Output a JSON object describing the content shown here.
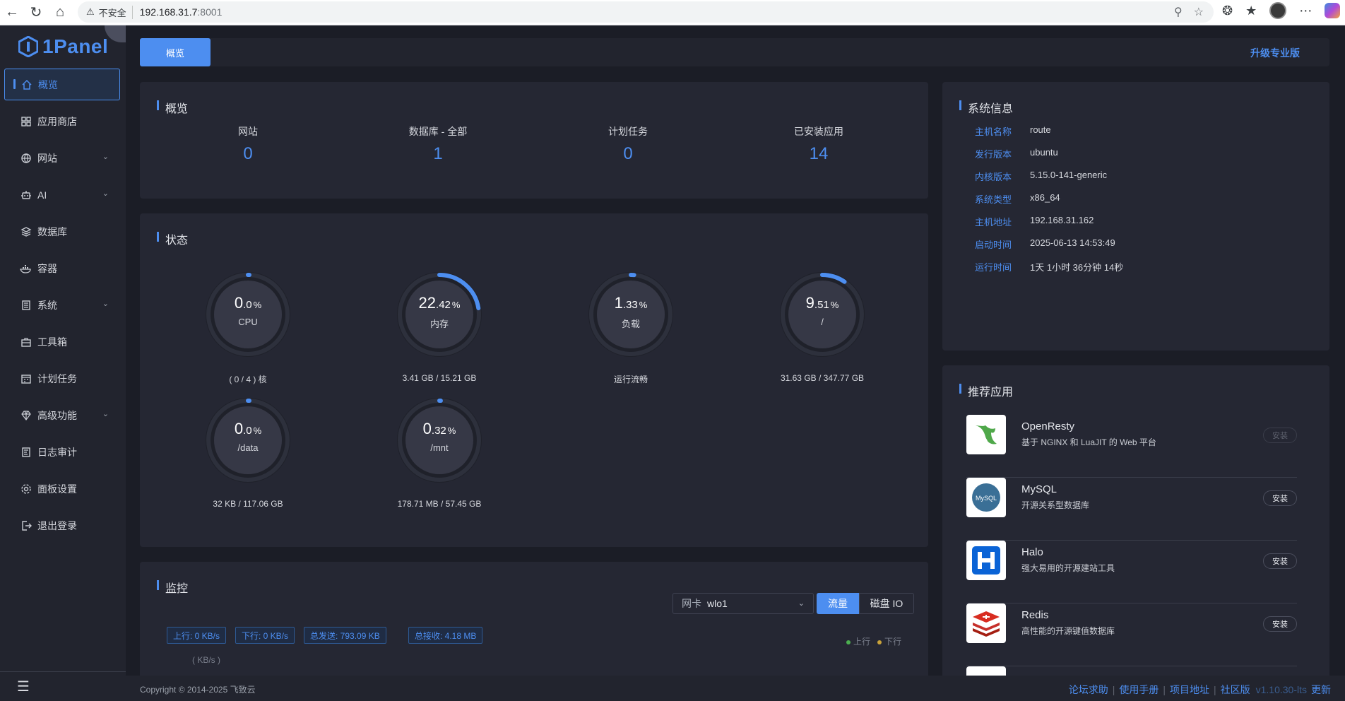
{
  "browser": {
    "security_label": "不安全",
    "url_host": "192.168.31.7",
    "url_port": ":8001"
  },
  "brand": {
    "name": "1Panel",
    "color": "#4d8ef0"
  },
  "sidebar": {
    "items": [
      {
        "label": "概览",
        "icon": "home-icon",
        "active": true
      },
      {
        "label": "应用商店",
        "icon": "grid-icon"
      },
      {
        "label": "网站",
        "icon": "globe-icon",
        "expandable": true
      },
      {
        "label": "AI",
        "icon": "robot-icon",
        "expandable": true
      },
      {
        "label": "数据库",
        "icon": "layers-icon"
      },
      {
        "label": "容器",
        "icon": "docker-icon"
      },
      {
        "label": "系统",
        "icon": "server-icon",
        "expandable": true
      },
      {
        "label": "工具箱",
        "icon": "toolbox-icon"
      },
      {
        "label": "计划任务",
        "icon": "calendar-icon"
      },
      {
        "label": "高级功能",
        "icon": "diamond-icon",
        "expandable": true
      },
      {
        "label": "日志审计",
        "icon": "log-icon"
      },
      {
        "label": "面板设置",
        "icon": "gear-icon"
      },
      {
        "label": "退出登录",
        "icon": "logout-icon"
      }
    ]
  },
  "topbar": {
    "tab": "概览",
    "upgrade": "升级专业版"
  },
  "overview": {
    "title": "概览",
    "items": [
      {
        "label": "网站",
        "value": "0"
      },
      {
        "label": "数据库 - 全部",
        "value": "1"
      },
      {
        "label": "计划任务",
        "value": "0"
      },
      {
        "label": "已安装应用",
        "value": "14"
      }
    ]
  },
  "status": {
    "title": "状态",
    "gauges": [
      {
        "int": "0",
        "dec": ".0",
        "unit": "%",
        "label": "CPU",
        "sub": "( 0 / 4 ) 核",
        "percent": 0.0
      },
      {
        "int": "22",
        "dec": ".42",
        "unit": "%",
        "label": "内存",
        "sub": "3.41 GB / 15.21 GB",
        "percent": 22.42
      },
      {
        "int": "1",
        "dec": ".33",
        "unit": "%",
        "label": "负载",
        "sub": "运行流畅",
        "percent": 1.33
      },
      {
        "int": "9",
        "dec": ".51",
        "unit": "%",
        "label": "/",
        "sub": "31.63 GB / 347.77 GB",
        "percent": 9.51
      },
      {
        "int": "0",
        "dec": ".0",
        "unit": "%",
        "label": "/data",
        "sub": "32 KB / 117.06 GB",
        "percent": 0.0
      },
      {
        "int": "0",
        "dec": ".32",
        "unit": "%",
        "label": "/mnt",
        "sub": "178.71 MB / 57.45 GB",
        "percent": 0.32
      }
    ]
  },
  "monitor": {
    "title": "监控",
    "nic_label": "网卡",
    "nic_value": "wlo1",
    "toggle_on": "流量",
    "toggle_off": "磁盘 IO",
    "tags": [
      "上行: 0 KB/s",
      "下行: 0 KB/s",
      "总发送: 793.09 KB",
      "总接收: 4.18 MB"
    ],
    "legend_up": "上行",
    "legend_down": "下行",
    "unit": "( KB/s )",
    "legend_up_color": "#4caf50",
    "legend_down_color": "#c9a23a"
  },
  "sysinfo": {
    "title": "系统信息",
    "rows": [
      {
        "key": "主机名称",
        "value": "route"
      },
      {
        "key": "发行版本",
        "value": "ubuntu"
      },
      {
        "key": "内核版本",
        "value": "5.15.0-141-generic"
      },
      {
        "key": "系统类型",
        "value": "x86_64"
      },
      {
        "key": "主机地址",
        "value": "192.168.31.162"
      },
      {
        "key": "启动时间",
        "value": "2025-06-13 14:53:49"
      },
      {
        "key": "运行时间",
        "value": "1天 1小时 36分钟 14秒"
      }
    ]
  },
  "apps": {
    "title": "推荐应用",
    "items": [
      {
        "name": "OpenResty",
        "desc": "基于 NGINX 和 LuaJIT 的 Web 平台",
        "button": "安装",
        "disabled": true,
        "icon": "openresty-icon"
      },
      {
        "name": "MySQL",
        "desc": "开源关系型数据库",
        "button": "安装",
        "icon": "mysql-icon"
      },
      {
        "name": "Halo",
        "desc": "强大易用的开源建站工具",
        "button": "安装",
        "icon": "halo-icon"
      },
      {
        "name": "Redis",
        "desc": "高性能的开源键值数据库",
        "button": "安装",
        "icon": "redis-icon"
      }
    ]
  },
  "footer": {
    "copyright": "Copyright © 2014-2025 飞致云",
    "links": [
      "论坛求助",
      "使用手册",
      "项目地址",
      "社区版"
    ],
    "version": "v1.10.30-lts",
    "update": "更新"
  }
}
